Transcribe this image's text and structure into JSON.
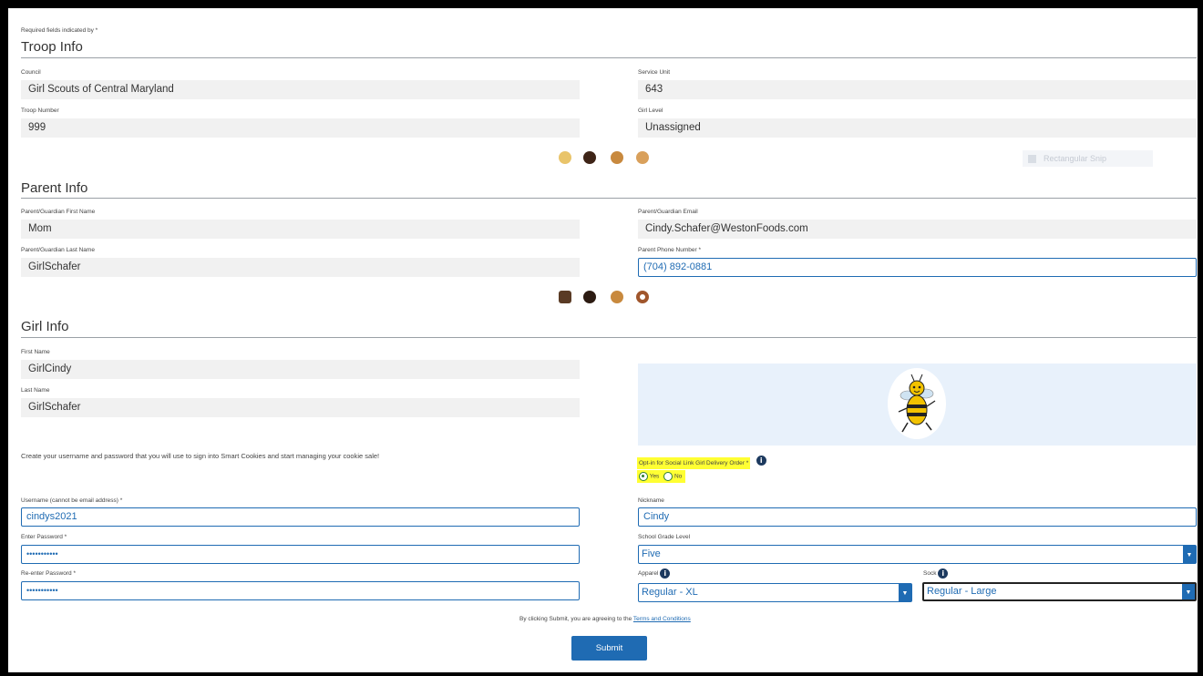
{
  "form": {
    "required_note": "Required fields indicated by *"
  },
  "troop": {
    "title": "Troop Info",
    "council": {
      "label": "Council",
      "value": "Girl Scouts of Central Maryland"
    },
    "service_unit": {
      "label": "Service Unit",
      "value": "643"
    },
    "troop_number": {
      "label": "Troop Number",
      "value": "999"
    },
    "girl_level": {
      "label": "Girl Level",
      "value": "Unassigned"
    }
  },
  "snip_overlay": {
    "label": "Rectangular Snip"
  },
  "parent": {
    "title": "Parent Info",
    "first_name": {
      "label": "Parent/Guardian First Name",
      "value": "Mom"
    },
    "email": {
      "label": "Parent/Guardian Email",
      "value": "Cindy.Schafer@WestonFoods.com"
    },
    "last_name": {
      "label": "Parent/Guardian Last Name",
      "value": "GirlSchafer"
    },
    "phone": {
      "label": "Parent Phone Number *",
      "value": "(704) 892-0881"
    }
  },
  "girl": {
    "title": "Girl Info",
    "first_name": {
      "label": "First Name",
      "value": "GirlCindy"
    },
    "last_name": {
      "label": "Last Name",
      "value": "GirlSchafer"
    },
    "create_account_text": "Create your username and password that you will use to sign into Smart Cookies and start managing your cookie sale!",
    "opt_in": {
      "label": "Opt-in for Social Link Girl Delivery Order *",
      "yes": "Yes",
      "no": "No",
      "selected": "Yes"
    },
    "username": {
      "label": "Username (cannot be email address) *",
      "value": "cindys2021"
    },
    "password": {
      "label": "Enter Password *",
      "value": "•••••••••••"
    },
    "password_confirm": {
      "label": "Re-enter Password *",
      "value": "•••••••••••"
    },
    "nickname": {
      "label": "Nickname",
      "value": "Cindy"
    },
    "school_grade": {
      "label": "School Grade Level",
      "value": "Five"
    },
    "apparel": {
      "label": "Apparel",
      "value": "Regular - XL"
    },
    "sock": {
      "label": "Sock",
      "value": "Regular - Large"
    }
  },
  "footer": {
    "agree_prefix": "By clicking Submit, you are agreeing to the",
    "terms_link": "Terms and Conditions",
    "submit_label": "Submit"
  },
  "colors": {
    "accent": "#1f6bb3",
    "highlight": "#ffff33",
    "avatar_bg": "#e8f1fb",
    "radio": "#2e7d32"
  },
  "icons": [
    "info-icon",
    "bee-mascot-image",
    "cookie-icon",
    "caret-down-icon"
  ]
}
